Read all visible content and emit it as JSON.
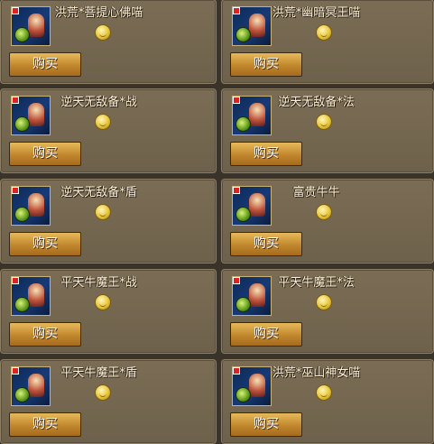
{
  "shop": {
    "items": [
      {
        "name": "洪荒*菩提心佛喵",
        "buy_label": "购买",
        "icon": "pet-bodhi-cat-icon"
      },
      {
        "name": "洪荒*幽暗冥王喵",
        "buy_label": "购买",
        "icon": "pet-dark-underworld-cat-icon"
      },
      {
        "name": "逆天无敌备*战",
        "buy_label": "购买",
        "icon": "pet-invincible-warrior-icon"
      },
      {
        "name": "逆天无敌备*法",
        "buy_label": "购买",
        "icon": "pet-invincible-mage-icon"
      },
      {
        "name": "逆天无敌备*盾",
        "buy_label": "购买",
        "icon": "pet-invincible-shield-icon"
      },
      {
        "name": "富贵牛牛",
        "buy_label": "购买",
        "icon": "pet-wealthy-bull-icon"
      },
      {
        "name": "平天牛魔王*战",
        "buy_label": "购买",
        "icon": "pet-bull-demon-warrior-icon"
      },
      {
        "name": "平天牛魔王*法",
        "buy_label": "购买",
        "icon": "pet-bull-demon-mage-icon"
      },
      {
        "name": "平天牛魔王*盾",
        "buy_label": "购买",
        "icon": "pet-bull-demon-shield-icon"
      },
      {
        "name": "洪荒*巫山神女喵",
        "buy_label": "购买",
        "icon": "pet-wushan-goddess-cat-icon"
      }
    ],
    "colors": {
      "panel": "#74664f",
      "button": "#c98f34",
      "name_text": "#fff3d6",
      "background": "#3a332a"
    }
  }
}
